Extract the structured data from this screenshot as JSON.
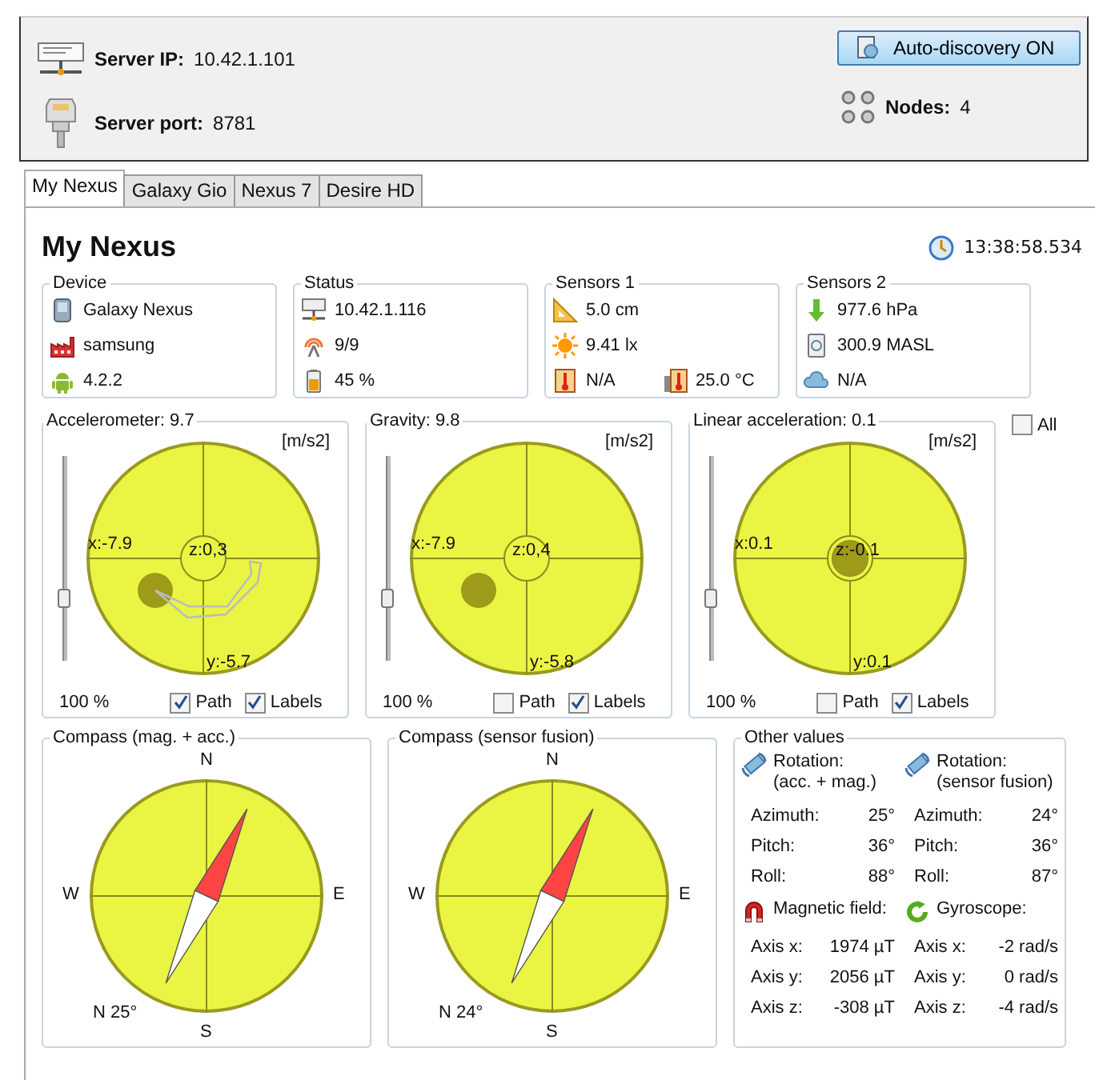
{
  "server": {
    "ip_label": "Server IP:",
    "ip": "10.42.1.101",
    "port_label": "Server port:",
    "port": "8781",
    "discovery_button": "Auto-discovery ON",
    "nodes_label": "Nodes:",
    "nodes": "4"
  },
  "tabs": [
    {
      "label": "My Nexus",
      "selected": true
    },
    {
      "label": "Galaxy Gio",
      "selected": false
    },
    {
      "label": "Nexus 7",
      "selected": false
    },
    {
      "label": "Desire HD",
      "selected": false
    }
  ],
  "device_title": "My Nexus",
  "time": "13:38:58.534",
  "cards": [
    {
      "title": "Device",
      "rows": [
        [
          {
            "kind": "phone",
            "text": "Galaxy Nexus"
          }
        ],
        [
          {
            "kind": "factory",
            "text": "samsung"
          }
        ],
        [
          {
            "kind": "android",
            "text": "4.2.2"
          }
        ]
      ]
    },
    {
      "title": "Status",
      "rows": [
        [
          {
            "kind": "network",
            "text": "10.42.1.116"
          }
        ],
        [
          {
            "kind": "signal",
            "text": "9/9"
          }
        ],
        [
          {
            "kind": "battery",
            "text": "45 %"
          }
        ]
      ]
    },
    {
      "title": "Sensors 1",
      "rows": [
        [
          {
            "kind": "ruler",
            "text": "5.0 cm"
          }
        ],
        [
          {
            "kind": "sun",
            "text": "9.41 lx"
          }
        ],
        [
          {
            "kind": "thermometer",
            "text": "N/A"
          },
          {
            "kind": "thermobox",
            "text": "25.0 °C"
          }
        ]
      ]
    },
    {
      "title": "Sensors 2",
      "rows": [
        [
          {
            "kind": "arrow",
            "text": "977.6 hPa"
          }
        ],
        [
          {
            "kind": "altimeter",
            "text": "300.9 MASL"
          }
        ],
        [
          {
            "kind": "cloud",
            "text": "N/A"
          }
        ]
      ]
    }
  ],
  "dials": [
    {
      "title": "Accelerometer: 9.7",
      "unit": "[m/s2]",
      "x_label": "x:-7.9",
      "z_label": "z:0,3",
      "y_label": "y:-5.7",
      "kind": "offset",
      "zoom": {
        "level": 0.3,
        "reading": "100 %"
      },
      "path": {
        "label": "Path",
        "checked": true
      },
      "labels": {
        "label": "Labels",
        "checked": true
      }
    },
    {
      "title": "Gravity: 9.8",
      "unit": "[m/s2]",
      "x_label": "x:-7.9",
      "z_label": "z:0,4",
      "y_label": "y:-5.8",
      "kind": "offset",
      "zoom": {
        "level": 0.3,
        "reading": "100 %"
      },
      "path": {
        "label": "Path",
        "checked": false
      },
      "labels": {
        "label": "Labels",
        "checked": true
      }
    },
    {
      "title": "Linear acceleration: 0.1",
      "unit": "[m/s2]",
      "x_label": "x:0.1",
      "z_label": "z:-0.1",
      "y_label": "y:0.1",
      "kind": "centered",
      "zoom": {
        "level": 0.3,
        "reading": "100 %"
      },
      "path": {
        "label": "Path",
        "checked": false
      },
      "labels": {
        "label": "Labels",
        "checked": true
      }
    }
  ],
  "all_checkbox": {
    "label": "All",
    "checked": false
  },
  "compasses": [
    {
      "title": "Compass (mag. + acc.)",
      "n": "N",
      "e": "E",
      "s": "S",
      "w": "W",
      "heading": "N 25°"
    },
    {
      "title": "Compass (sensor fusion)",
      "n": "N",
      "e": "E",
      "s": "S",
      "w": "W",
      "heading": "N 24°"
    }
  ],
  "other_values": {
    "title": "Other values",
    "groups": [
      {
        "kind": "rotation",
        "title": "Rotation:\n(acc. + mag.)",
        "rows": [
          {
            "label": "Azimuth:",
            "value": "25°"
          },
          {
            "label": "Pitch:",
            "value": "36°"
          },
          {
            "label": "Roll:",
            "value": "88°"
          }
        ]
      },
      {
        "kind": "rotation",
        "title": "Rotation:\n(sensor fusion)",
        "rows": [
          {
            "label": "Azimuth:",
            "value": "24°"
          },
          {
            "label": "Pitch:",
            "value": "36°"
          },
          {
            "label": "Roll:",
            "value": "87°"
          }
        ]
      },
      {
        "kind": "magnet",
        "title": "Magnetic field:",
        "rows": [
          {
            "label": "Axis x:",
            "value": "1974 µT"
          },
          {
            "label": "Axis y:",
            "value": "2056 µT"
          },
          {
            "label": "Axis z:",
            "value": "-308 µT"
          }
        ]
      },
      {
        "kind": "gyro",
        "title": "Gyroscope:",
        "rows": [
          {
            "label": "Axis x:",
            "value": "-2 rad/s"
          },
          {
            "label": "Axis y:",
            "value": "0 rad/s"
          },
          {
            "label": "Axis z:",
            "value": "-4 rad/s"
          }
        ]
      }
    ]
  }
}
